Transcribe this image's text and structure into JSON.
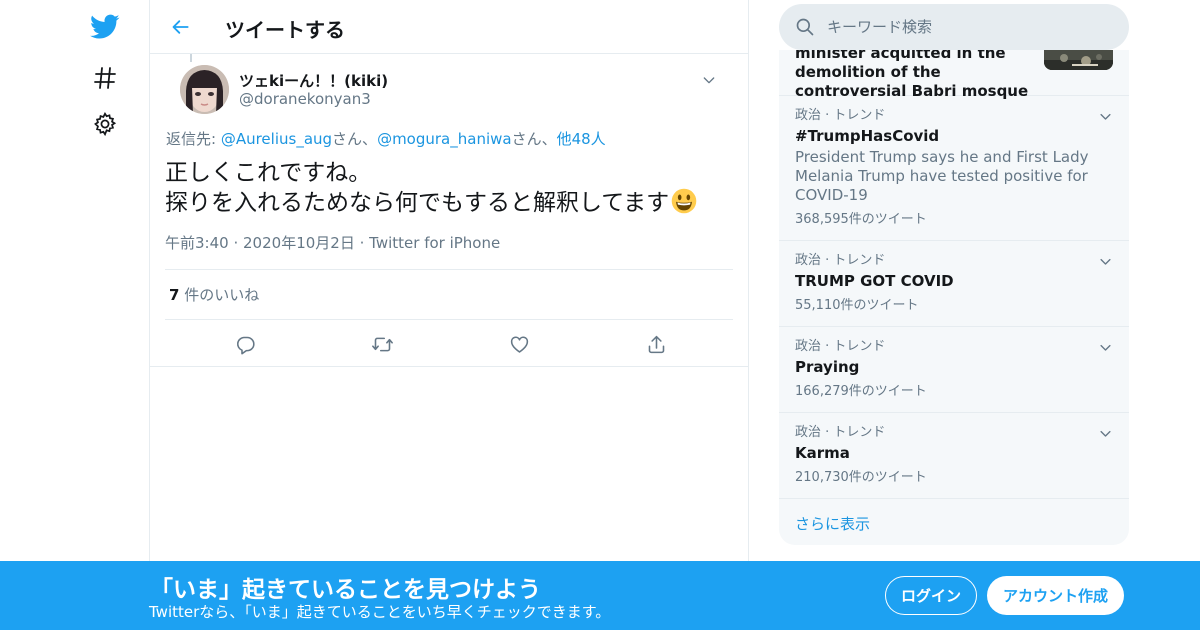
{
  "colors": {
    "accent": "#1da1f2",
    "link": "#1b95e0",
    "text": "#14171a",
    "muted": "#657786",
    "border": "#e6ecf0"
  },
  "nav": {
    "logo_icon": "twitter-bird-icon",
    "explore_icon": "hashtag-icon",
    "settings_icon": "gear-icon"
  },
  "header": {
    "title": "ツイートする",
    "back_icon": "arrow-left-icon"
  },
  "tweet": {
    "author_name": "ツェkiーん！！(kiki)",
    "author_handle": "@doranekonyan3",
    "reply_prefix": "返信先: ",
    "reply_user1": "@Aurelius_aug",
    "reply_san1": "さん、",
    "reply_user2": "@mogura_haniwa",
    "reply_san2": "さん、",
    "reply_others": "他48人",
    "text_line1": "正しくこれですね。",
    "text_line2": "探りを入れるためなら何でもすると解釈してます",
    "emoji": "grinning-face-emoji",
    "time": "午前3:40",
    "date": "2020年10月2日",
    "source": "Twitter for iPhone",
    "likes_count": "7",
    "likes_label": " 件のいいね",
    "actions": [
      "reply-icon",
      "retweet-icon",
      "like-icon",
      "share-icon"
    ]
  },
  "search": {
    "placeholder": "キーワード検索"
  },
  "trends": {
    "top_partial": "minister acquitted in the demolition of the controversial Babri mosque",
    "items": [
      {
        "context": "政治 · トレンド",
        "name": "#TrumpHasCovid",
        "desc": "President Trump says he and First Lady Melania Trump have tested positive for COVID-19",
        "count": "368,595件のツイート"
      },
      {
        "context": "政治 · トレンド",
        "name": "TRUMP GOT COVID",
        "desc": "",
        "count": "55,110件のツイート"
      },
      {
        "context": "政治 · トレンド",
        "name": "Praying",
        "desc": "",
        "count": "166,279件のツイート"
      },
      {
        "context": "政治 · トレンド",
        "name": "Karma",
        "desc": "",
        "count": "210,730件のツイート"
      }
    ],
    "show_more": "さらに表示"
  },
  "banner": {
    "title": "「いま」起きていることを見つけよう",
    "subtitle": "Twitterなら、「いま」起きていることをいち早くチェックできます。",
    "login": "ログイン",
    "signup": "アカウント作成"
  }
}
